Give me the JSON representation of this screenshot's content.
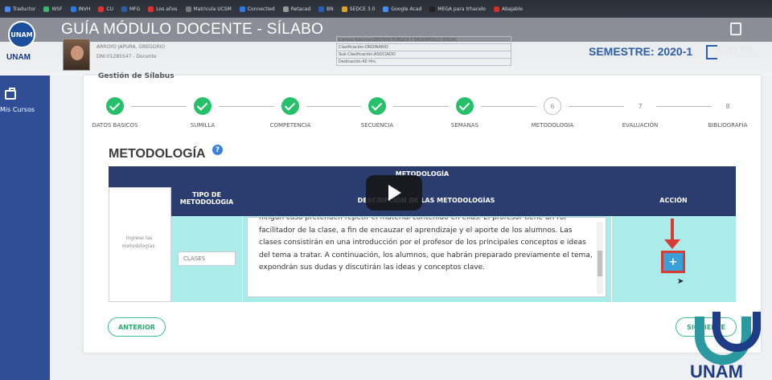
{
  "browser": {
    "bookmarks": [
      {
        "label": "Traductor",
        "color": "#4a8af4"
      },
      {
        "label": "WSF",
        "color": "#3cb371"
      },
      {
        "label": "INVH",
        "color": "#2a7ae2"
      },
      {
        "label": "CU",
        "color": "#d33"
      },
      {
        "label": "MFG",
        "color": "#2a5db0"
      },
      {
        "label": "Los años",
        "color": "#d33"
      },
      {
        "label": "Matricula UCSM",
        "color": "#777"
      },
      {
        "label": "Connectied",
        "color": "#2a7ae2"
      },
      {
        "label": "Retacad",
        "color": "#999"
      },
      {
        "label": "BN",
        "color": "#2a5db0"
      },
      {
        "label": "SEDCE 3.0",
        "color": "#e0a020"
      },
      {
        "label": "Google Acad",
        "color": "#4a8af4"
      },
      {
        "label": "MEGA para trhacelo",
        "color": "#222"
      },
      {
        "label": "Abajable",
        "color": "#c9302c"
      }
    ]
  },
  "header": {
    "logo_badge": "UNAM",
    "logo_text": "UNAM",
    "title": "GUÍA MÓDULO DOCENTE - SÍLABO",
    "user_name": "ARROYO JAPURA, GREGORIO",
    "user_dni": "DNI:01285547 - Docente",
    "info": [
      "Carrera Adscrita:GESTION PUBLICA Y DESARROLLO SOCIAL",
      "Clasificación:ORDINARIO",
      "Sub Clasificación:ASOCIADO",
      "Dedicación:40 Hrs."
    ],
    "semestre": "SEMESTRE: 2020-1",
    "copy_link": "Copy link"
  },
  "sidebar": {
    "items": [
      {
        "label": "Mis Cursos",
        "icon": "briefcase-icon"
      }
    ]
  },
  "panel": {
    "title": "Gestión de Sílabus"
  },
  "stepper": {
    "steps": [
      {
        "label": "DATOS BASICOS",
        "state": "done",
        "num": ""
      },
      {
        "label": "SUMILLA",
        "state": "done",
        "num": ""
      },
      {
        "label": "COMPETENCIA",
        "state": "done",
        "num": ""
      },
      {
        "label": "SECUENCIA",
        "state": "done",
        "num": ""
      },
      {
        "label": "SEMANAS",
        "state": "done",
        "num": ""
      },
      {
        "label": "METODOLOGIA",
        "state": "current",
        "num": "6"
      },
      {
        "label": "EVALUACIÓN",
        "state": "pending",
        "num": "7"
      },
      {
        "label": "BIBLIOGRAFÍA",
        "state": "pending",
        "num": "8"
      }
    ]
  },
  "section": {
    "title": "METODOLOGÍA",
    "help": "?"
  },
  "table": {
    "top_label": "METODOLOGÍA",
    "col_tipo": "TIPO DE METODOLOGIA",
    "col_desc": "DESCRIPCIÓN DE LAS METODOLOGÍAS",
    "col_accion": "ACCIÓN",
    "ingrese": "Ingrese las metodologías:",
    "tipo_value": "CLASES",
    "description": "ningún caso pretenden repetir el material contenido en ellas. El profesor tiene un rol facilitador de la clase, a fin de encauzar el aprendizaje y el aporte de los alumnos. Las clases consistirán en una introducción por el profesor de los principales conceptos e ideas del tema a tratar. A continuación, los alumnos, que habrán preparado previamente el tema, expondrán sus dudas y discutirán las ideas y conceptos clave.",
    "add_label": "+"
  },
  "nav": {
    "anterior": "ANTERIOR",
    "siguiente": "SIGUIENTE"
  },
  "watermark": {
    "text": "UNAM"
  }
}
